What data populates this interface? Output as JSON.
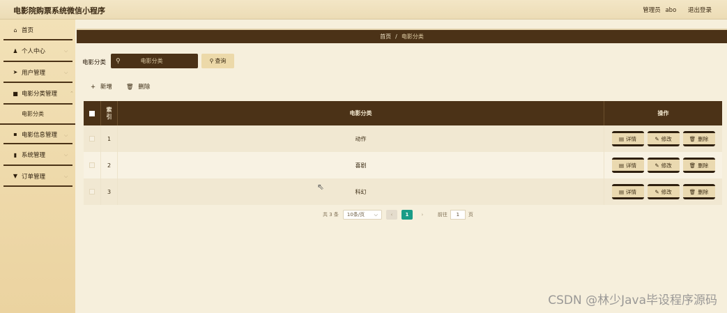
{
  "app": {
    "title": "电影院购票系统微信小程序"
  },
  "header": {
    "user_role": "管理员",
    "username": "abo",
    "logout_label": "退出登录"
  },
  "sidebar": {
    "items": [
      {
        "label": "首页",
        "icon": "home-icon",
        "glyph": "⌂"
      },
      {
        "label": "个人中心",
        "icon": "user-icon",
        "glyph": "♟"
      },
      {
        "label": "用户管理",
        "icon": "send-icon",
        "glyph": "➤"
      },
      {
        "label": "电影分类管理",
        "icon": "folder-icon",
        "glyph": "■"
      },
      {
        "label": "电影信息管理",
        "icon": "grid-icon",
        "glyph": "▪"
      },
      {
        "label": "系统管理",
        "icon": "chart-icon",
        "glyph": "▮"
      },
      {
        "label": "订单管理",
        "icon": "filter-icon",
        "glyph": "▼"
      }
    ],
    "subitem": "电影分类"
  },
  "breadcrumb": {
    "home": "首页",
    "separator": "/",
    "current": "电影分类"
  },
  "search": {
    "label": "电影分类",
    "placeholder": "电影分类",
    "button_label": "查询"
  },
  "toolbar": {
    "add_label": "新增",
    "delete_label": "删除"
  },
  "table": {
    "headers": {
      "index": "索引",
      "name": "电影分类",
      "actions": "操作"
    },
    "rows": [
      {
        "index": "1",
        "name": "动作"
      },
      {
        "index": "2",
        "name": "喜剧"
      },
      {
        "index": "3",
        "name": "科幻"
      }
    ],
    "actions": {
      "detail": "详情",
      "edit": "修改",
      "delete": "删除"
    }
  },
  "pagination": {
    "total_text": "共 3 条",
    "page_size": "10条/页",
    "current_page": "1",
    "goto_label": "前往",
    "goto_value": "1",
    "page_unit": "页"
  },
  "watermark": "CSDN @林少Java毕设程序源码",
  "colors": {
    "primary": "#4b3217",
    "sidebar": "#f2e1b7",
    "background": "#f6efdc",
    "page_active": "#1a9c87"
  }
}
